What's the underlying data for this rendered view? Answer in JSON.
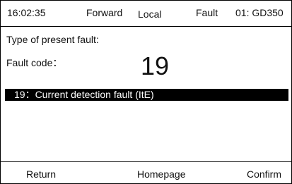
{
  "status_bar": {
    "time": "16:02:35",
    "direction": "Forward",
    "mode": "Local",
    "state": "Fault",
    "device": "01: GD350"
  },
  "content": {
    "type_label": "Type of present fault:",
    "code_label": "Fault code：",
    "code_value": "19",
    "fault_description": "19：Current detection fault (ItE)"
  },
  "footer": {
    "return_label": "Return",
    "home_label": "Homepage",
    "confirm_label": "Confirm"
  }
}
